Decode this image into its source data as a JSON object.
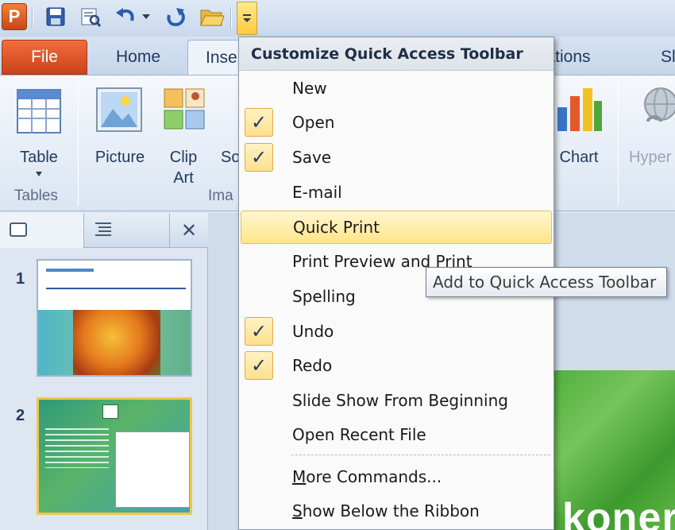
{
  "window": {
    "app_initial": "P"
  },
  "tabs": {
    "file": "File",
    "home": "Home",
    "insert": "Inse",
    "animations": "mations",
    "slideshow": "Sl"
  },
  "ribbon": {
    "table_label": "Table",
    "picture_label": "Picture",
    "clip_label": "Clip",
    "art_label": "Art",
    "so_label": "So",
    "chart_label": "Chart",
    "hyper_label": "Hyper",
    "tables_group": "Tables",
    "images_group": "Ima"
  },
  "slides": [
    {
      "number": "1"
    },
    {
      "number": "2"
    }
  ],
  "slide_text": "koner",
  "menu": {
    "title": "Customize Quick Access Toolbar",
    "items": [
      {
        "label": "New",
        "checked": false
      },
      {
        "label": "Open",
        "checked": true
      },
      {
        "label": "Save",
        "checked": true
      },
      {
        "label": "E-mail",
        "checked": false
      },
      {
        "label": "Quick Print",
        "checked": false
      },
      {
        "label": "Print Preview and Print",
        "checked": false
      },
      {
        "label": "Spelling",
        "checked": false
      },
      {
        "label": "Undo",
        "checked": true
      },
      {
        "label": "Redo",
        "checked": true
      },
      {
        "label": "Slide Show From Beginning",
        "checked": false
      },
      {
        "label": "Open Recent File",
        "checked": false
      }
    ],
    "more_commands": {
      "first": "M",
      "rest": "ore Commands..."
    },
    "show_below": {
      "first": "S",
      "rest": "how Below the Ribbon"
    },
    "check_glyph": "✓"
  },
  "tooltip": "Add to Quick Access Toolbar"
}
